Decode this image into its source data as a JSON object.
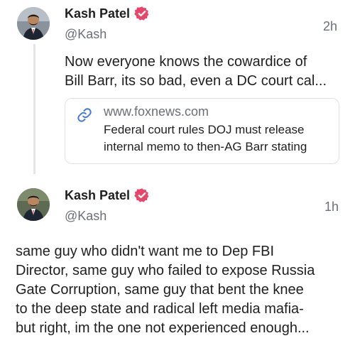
{
  "posts": [
    {
      "author": "Kash Patel",
      "handle": "@Kash",
      "time": "2h",
      "text_lines": [
        "Now everyone knows the cowardice of",
        "Bill Barr, its so bad, even a DC court cal..."
      ],
      "link": {
        "url": "www.foxnews.com",
        "title_lines": [
          "Federal court rules DOJ must release",
          "internal memo to then-AG Barr stating"
        ]
      }
    },
    {
      "author": "Kash Patel",
      "handle": "@Kash",
      "time": "1h",
      "text_lines": [
        "same guy who didn't want me to Dep FBI",
        "Director, same guy who failed to expose Russia",
        "Gate Corruption, same guy that bent the knee",
        "to the deep state and radical left media mafia-",
        "but right, im the one not experienced enough..."
      ]
    }
  ],
  "colors": {
    "verified_badge": "#e8456b",
    "link_icon": "#4a7bd6"
  }
}
